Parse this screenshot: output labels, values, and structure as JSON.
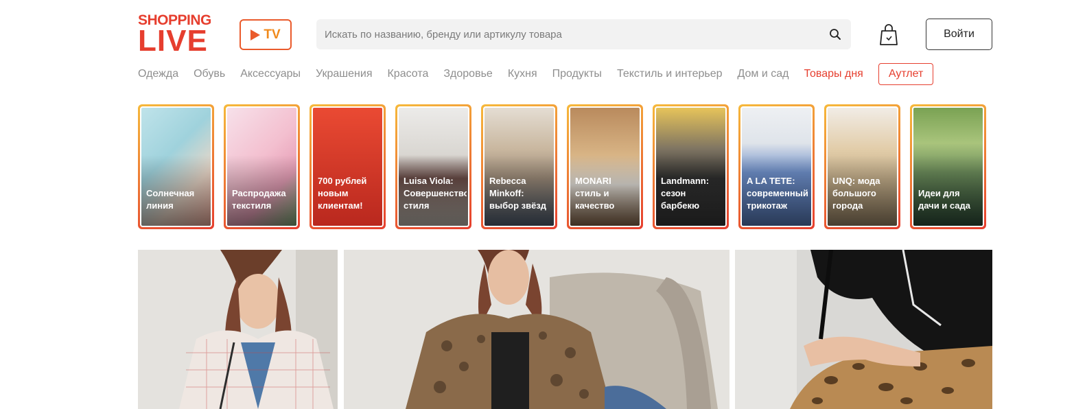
{
  "header": {
    "logo_line1": "SHOPPING",
    "logo_line2": "LIVE",
    "tv_label": "TV",
    "search_placeholder": "Искать по названию, бренду или артикулу товара",
    "login_label": "Войти"
  },
  "nav": {
    "items": [
      "Одежда",
      "Обувь",
      "Аксессуары",
      "Украшения",
      "Красота",
      "Здоровье",
      "Кухня",
      "Продукты",
      "Текстиль и интерьер",
      "Дом и сад"
    ],
    "deals": "Товары дня",
    "outlet": "Аутлет"
  },
  "stories": [
    {
      "label": "Солнечная\nлиния"
    },
    {
      "label": "Распродажа\nтекстиля"
    },
    {
      "label": "700 рублей\nновым\nклиентам!"
    },
    {
      "label": "Luisa Viola:\nСовершенство\nстиля"
    },
    {
      "label": "Rebecca\nMinkoff:\nвыбор звёзд"
    },
    {
      "label": "MONARI\nстиль и\nкачество"
    },
    {
      "label": "Landmann:\nсезон\nбарбекю"
    },
    {
      "label": "A LA TETE:\nсовременный\nтрикотаж"
    },
    {
      "label": "UNQ: мода\nбольшого\nгорода"
    },
    {
      "label": "Идеи для\nдачи и сада"
    }
  ],
  "colors": {
    "brand": "#e63e2e",
    "tv_accent": "#f08a1c",
    "nav_text": "#8e8e8e"
  },
  "icons": {
    "tv": "play-icon",
    "search": "search-icon",
    "cart": "shopping-bag-icon"
  }
}
